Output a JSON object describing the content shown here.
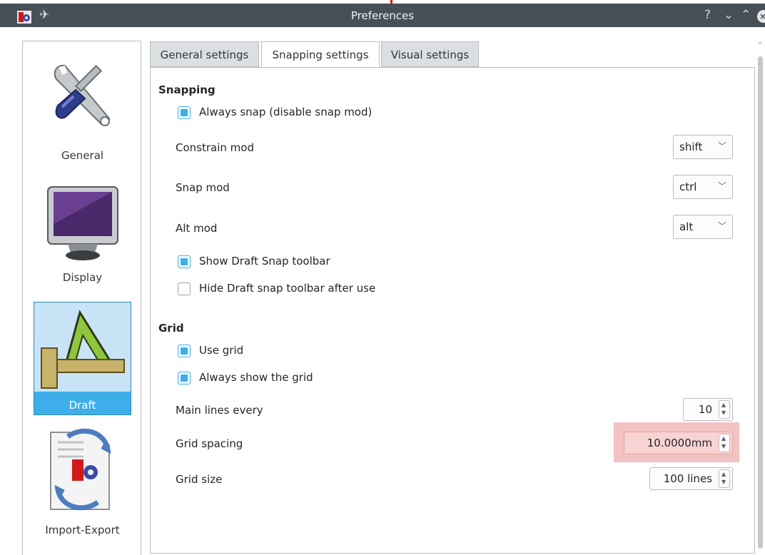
{
  "window": {
    "title": "Preferences",
    "help_btn": "?",
    "minimize_btn": "⌄",
    "maximize_btn": "⌃",
    "close_btn": "×"
  },
  "sidebar": {
    "items": [
      {
        "label": "General",
        "icon": "tools-icon"
      },
      {
        "label": "Display",
        "icon": "monitor-icon"
      },
      {
        "label": "Draft",
        "icon": "draft-icon",
        "selected": true
      },
      {
        "label": "Import-Export",
        "icon": "import-export-icon"
      }
    ]
  },
  "tabs": [
    {
      "label": "General settings"
    },
    {
      "label": "Snapping settings",
      "active": true
    },
    {
      "label": "Visual settings"
    }
  ],
  "snapping": {
    "title": "Snapping",
    "always_snap": {
      "label": "Always snap (disable snap mod)",
      "checked": true
    },
    "constrain_mod": {
      "label": "Constrain mod",
      "value": "shift"
    },
    "snap_mod": {
      "label": "Snap mod",
      "value": "ctrl"
    },
    "alt_mod": {
      "label": "Alt mod",
      "value": "alt"
    },
    "show_toolbar": {
      "label": "Show Draft Snap toolbar",
      "checked": true
    },
    "hide_toolbar": {
      "label": "Hide Draft snap toolbar after use",
      "checked": false
    }
  },
  "grid": {
    "title": "Grid",
    "use_grid": {
      "label": "Use grid",
      "checked": true
    },
    "always_show": {
      "label": "Always show the grid",
      "checked": true
    },
    "main_lines": {
      "label": "Main lines every",
      "value": "10"
    },
    "spacing": {
      "label": "Grid spacing",
      "value": "10.0000mm"
    },
    "size": {
      "label": "Grid size",
      "value": "100 lines"
    }
  },
  "colors": {
    "accent": "#3daee9",
    "titlebar": "#475057",
    "highlight": "#f3c2c2"
  }
}
